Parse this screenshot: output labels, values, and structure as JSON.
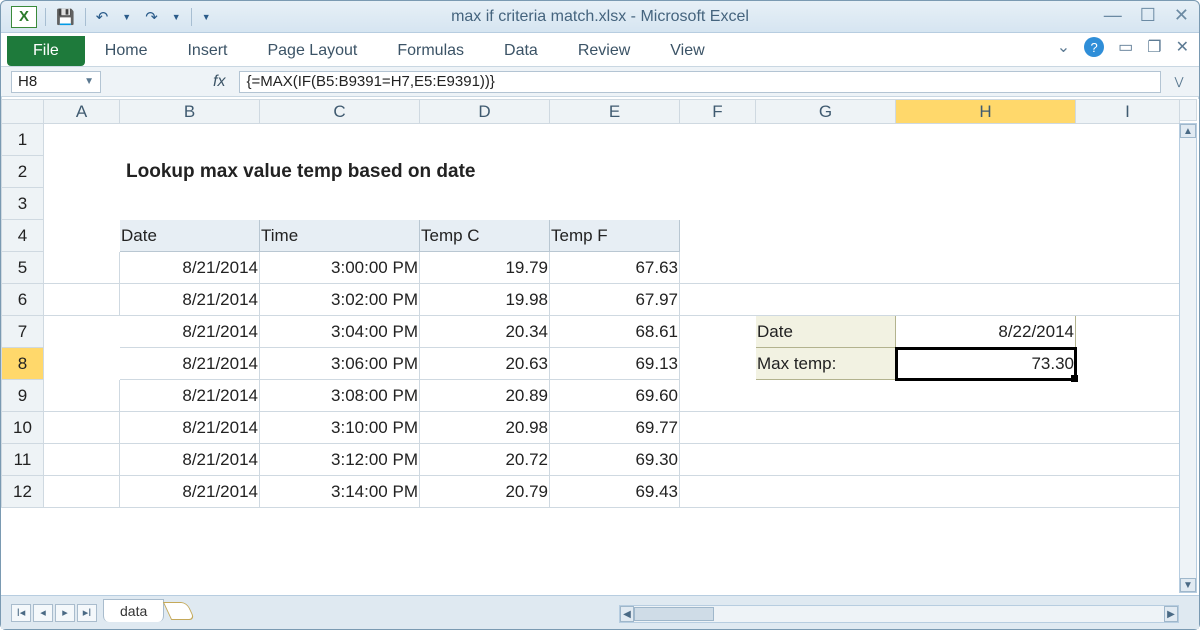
{
  "title": "max if criteria match.xlsx - Microsoft Excel",
  "qat": {
    "save": "💾",
    "undo": "↶",
    "redo": "↷"
  },
  "winctl": {
    "min": "—",
    "max": "☐",
    "close": "✕"
  },
  "ribbon": {
    "file": "File",
    "tabs": [
      "Home",
      "Insert",
      "Page Layout",
      "Formulas",
      "Data",
      "Review",
      "View"
    ],
    "chevron": "⌄",
    "help": "?",
    "minbox": "▭",
    "restore": "❐",
    "closex": "✕"
  },
  "fx": {
    "cellref": "H8",
    "label": "fx",
    "formula": "{=MAX(IF(B5:B9391=H7,E5:E9391))}"
  },
  "cols": [
    "A",
    "B",
    "C",
    "D",
    "E",
    "F",
    "G",
    "H",
    "I"
  ],
  "rows": [
    "1",
    "2",
    "3",
    "4",
    "5",
    "6",
    "7",
    "8",
    "9",
    "10",
    "11",
    "12"
  ],
  "sheet": {
    "title": "Lookup max value temp based on date",
    "headers": {
      "b": "Date",
      "c": "Time",
      "d": "Temp C",
      "e": "Temp F"
    },
    "data": [
      {
        "b": "8/21/2014",
        "c": "3:00:00 PM",
        "d": "19.79",
        "e": "67.63"
      },
      {
        "b": "8/21/2014",
        "c": "3:02:00 PM",
        "d": "19.98",
        "e": "67.97"
      },
      {
        "b": "8/21/2014",
        "c": "3:04:00 PM",
        "d": "20.34",
        "e": "68.61"
      },
      {
        "b": "8/21/2014",
        "c": "3:06:00 PM",
        "d": "20.63",
        "e": "69.13"
      },
      {
        "b": "8/21/2014",
        "c": "3:08:00 PM",
        "d": "20.89",
        "e": "69.60"
      },
      {
        "b": "8/21/2014",
        "c": "3:10:00 PM",
        "d": "20.98",
        "e": "69.77"
      },
      {
        "b": "8/21/2014",
        "c": "3:12:00 PM",
        "d": "20.72",
        "e": "69.30"
      },
      {
        "b": "8/21/2014",
        "c": "3:14:00 PM",
        "d": "20.79",
        "e": "69.43"
      }
    ],
    "lookup": {
      "dateLabel": "Date",
      "dateVal": "8/22/2014",
      "maxLabel": "Max temp:",
      "maxVal": "73.30"
    }
  },
  "status": {
    "nav": [
      "I◂",
      "◂",
      "▸",
      "▸I"
    ],
    "sheet": "data"
  },
  "appglyph": "X"
}
